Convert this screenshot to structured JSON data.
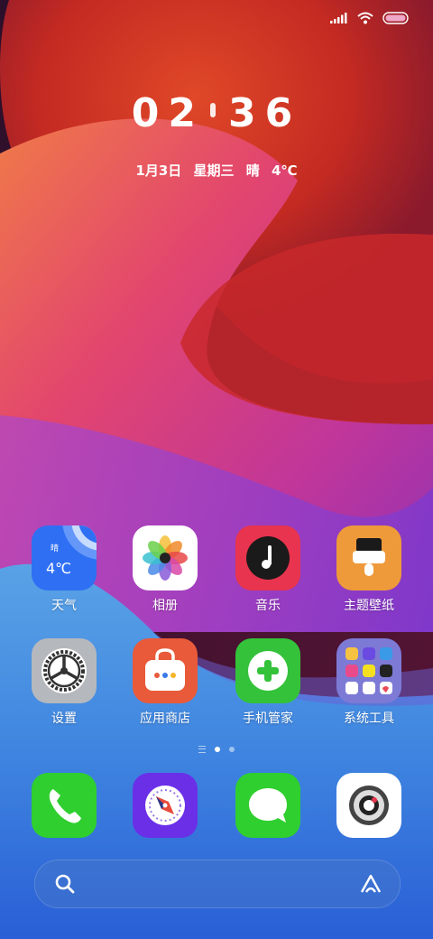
{
  "status_bar": {
    "icons": [
      "signal-icon",
      "wifi-icon",
      "battery-icon"
    ]
  },
  "clock": {
    "hour": "02",
    "minute": "36"
  },
  "date_line": {
    "date": "1月3日",
    "weekday": "星期三",
    "weather": "晴",
    "temperature": "4℃"
  },
  "weather_widget": {
    "condition": "晴",
    "temperature": "4℃"
  },
  "apps": [
    {
      "label": "天气",
      "icon": "weather-icon",
      "color": "#2f6ff3"
    },
    {
      "label": "相册",
      "icon": "photos-flower-icon",
      "color": "#ffffff"
    },
    {
      "label": "音乐",
      "icon": "music-note-icon",
      "color": "#e8344e"
    },
    {
      "label": "主题壁纸",
      "icon": "theme-brush-icon",
      "color": "#ee9a3a"
    },
    {
      "label": "设置",
      "icon": "settings-gear-icon",
      "color": "#b5b8bd"
    },
    {
      "label": "应用商店",
      "icon": "app-store-bag-icon",
      "color": "#e85a3a"
    },
    {
      "label": "手机管家",
      "icon": "phone-manager-plus-icon",
      "color": "#33c23a"
    },
    {
      "label": "系统工具",
      "icon": "folder-icon",
      "color": "#7d7ad6"
    }
  ],
  "dock": [
    {
      "icon": "phone-icon",
      "color": "#2fcf2f"
    },
    {
      "icon": "browser-compass-icon",
      "color": "#6b2fe8"
    },
    {
      "icon": "messages-icon",
      "color": "#2fcf2f"
    },
    {
      "icon": "camera-icon",
      "color": "#ffffff"
    }
  ],
  "pager": {
    "pages": 2,
    "active": 1
  },
  "search_bar": {
    "left_icon": "search-icon",
    "right_icon": "assistant-icon"
  }
}
